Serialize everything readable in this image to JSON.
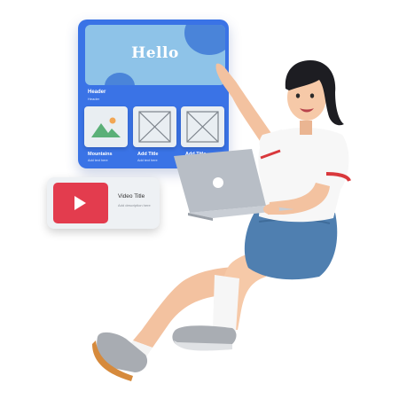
{
  "wireframe": {
    "hero_title": "Hello",
    "header_label": "Header",
    "header_sub": "Header",
    "thumbs": [
      {
        "title": "Mountains",
        "sub": "Add text here",
        "icon": "landscape-icon"
      },
      {
        "title": "Add Title",
        "sub": "Add text here",
        "icon": "image-placeholder-icon"
      },
      {
        "title": "Add Title",
        "sub": "Add text here",
        "icon": "image-placeholder-icon"
      }
    ]
  },
  "video_card": {
    "title": "Video Title",
    "description": "Add description here",
    "icon": "play-icon"
  },
  "colors": {
    "card_blue": "#3a73e6",
    "hero_blue": "#8ec3e8",
    "video_red": "#e33c4e",
    "skirt_blue": "#4f7fb0",
    "laptop_gray": "#b8bec6"
  }
}
